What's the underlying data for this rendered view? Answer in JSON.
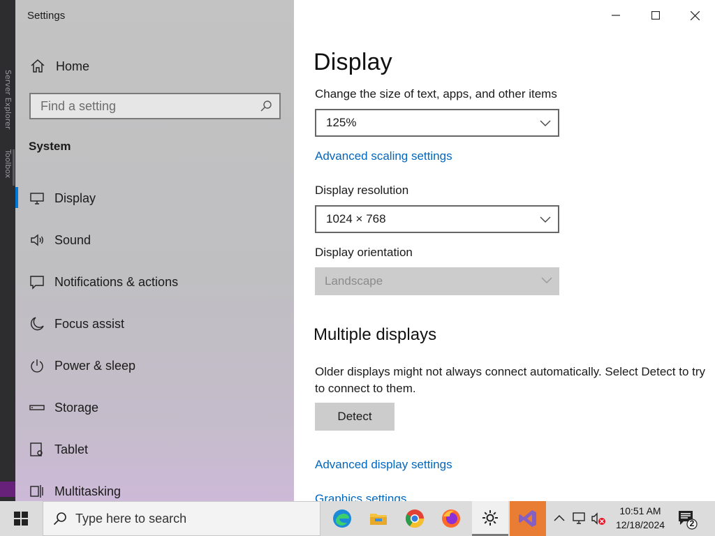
{
  "window": {
    "title": "Settings"
  },
  "nav": {
    "home": "Home",
    "search_placeholder": "Find a setting",
    "section": "System",
    "items": [
      {
        "label": "Display",
        "icon": "monitor-icon",
        "selected": true
      },
      {
        "label": "Sound",
        "icon": "speaker-icon"
      },
      {
        "label": "Notifications & actions",
        "icon": "notification-icon"
      },
      {
        "label": "Focus assist",
        "icon": "moon-icon"
      },
      {
        "label": "Power & sleep",
        "icon": "power-icon"
      },
      {
        "label": "Storage",
        "icon": "storage-icon"
      },
      {
        "label": "Tablet",
        "icon": "tablet-icon"
      },
      {
        "label": "Multitasking",
        "icon": "multitasking-icon"
      }
    ]
  },
  "content": {
    "title": "Display",
    "scale_label": "Change the size of text, apps, and other items",
    "scale_value": "125%",
    "advanced_scaling": "Advanced scaling settings",
    "resolution_label": "Display resolution",
    "resolution_value": "1024 × 768",
    "orientation_label": "Display orientation",
    "orientation_value": "Landscape",
    "multiple_title": "Multiple displays",
    "multiple_desc": "Older displays might not always connect automatically. Select Detect to try to connect to them.",
    "detect_button": "Detect",
    "advanced_display": "Advanced display settings",
    "graphics_settings": "Graphics settings"
  },
  "background_app": {
    "tabs": [
      "Server Explorer",
      "Toolbox"
    ]
  },
  "taskbar": {
    "search_placeholder": "Type here to search",
    "time": "10:51 AM",
    "date": "12/18/2024",
    "notification_count": "2",
    "accent": "#0078d7"
  }
}
